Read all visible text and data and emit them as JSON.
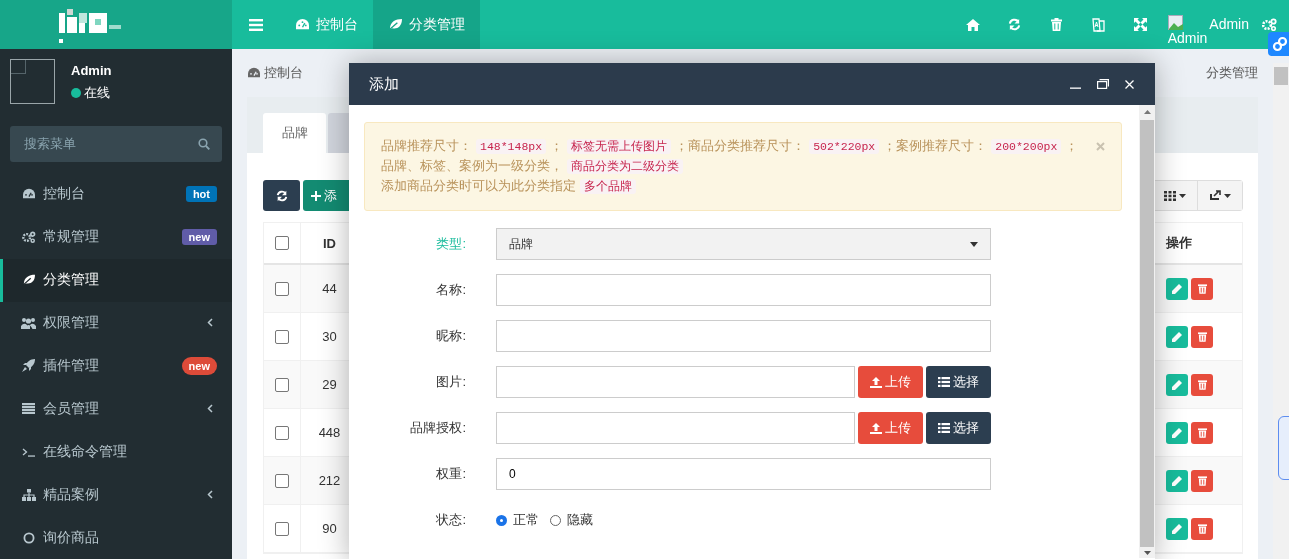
{
  "header": {
    "nav_tabs": [
      {
        "label": "控制台",
        "selected": false
      },
      {
        "label": "分类管理",
        "selected": true
      }
    ],
    "user": {
      "image_alt": "Admin",
      "name": "Admin"
    }
  },
  "sidebar": {
    "user": {
      "name": "Admin",
      "status": "在线"
    },
    "search": {
      "placeholder": "搜索菜单"
    },
    "items": [
      {
        "label": "控制台",
        "badge": {
          "text": "hot",
          "color": "#0073b7",
          "pill": false
        },
        "expandable": false,
        "selected": false
      },
      {
        "label": "常规管理",
        "badge": {
          "text": "new",
          "color": "#605ca8",
          "pill": false
        },
        "expandable": false,
        "selected": false
      },
      {
        "label": "分类管理",
        "expandable": false,
        "selected": true
      },
      {
        "label": "权限管理",
        "expandable": true,
        "selected": false
      },
      {
        "label": "插件管理",
        "badge": {
          "text": "new",
          "color": "#dd4b39",
          "pill": true
        },
        "expandable": false,
        "selected": false
      },
      {
        "label": "会员管理",
        "expandable": true,
        "selected": false
      },
      {
        "label": "在线命令管理",
        "expandable": false,
        "selected": false
      },
      {
        "label": "精品案例",
        "expandable": true,
        "selected": false
      },
      {
        "label": "询价商品",
        "expandable": false,
        "selected": false
      }
    ]
  },
  "breadcrumb": {
    "left": "控制台",
    "right": "分类管理"
  },
  "panel": {
    "tabs": [
      {
        "label": "品牌",
        "selected": true
      },
      {
        "selected": false
      }
    ],
    "add_label": "添",
    "table": {
      "header_checked": false,
      "id_heading": "ID",
      "actions_heading": "操作",
      "rows": [
        {
          "id": "44",
          "checked": false
        },
        {
          "id": "30",
          "checked": false
        },
        {
          "id": "29",
          "checked": false
        },
        {
          "id": "448",
          "checked": false
        },
        {
          "id": "212",
          "checked": false
        },
        {
          "id": "90",
          "checked": false
        }
      ]
    }
  },
  "modal": {
    "title": "添加",
    "alert": {
      "lines": [
        [
          {
            "kind": "text",
            "text": "品牌推荐尺寸："
          },
          {
            "kind": "code",
            "text": "148*148px"
          },
          {
            "kind": "text",
            "text": "；"
          },
          {
            "kind": "code",
            "text": "标签无需上传图片"
          },
          {
            "kind": "text",
            "text": "；商品分类推荐尺寸："
          },
          {
            "kind": "code",
            "text": "502*220px"
          },
          {
            "kind": "text",
            "text": "；案例推荐尺寸："
          },
          {
            "kind": "code",
            "text": "200*200px"
          },
          {
            "kind": "text",
            "text": "；"
          }
        ],
        [
          {
            "kind": "text",
            "text": "品牌、标签、案例为一级分类，"
          },
          {
            "kind": "code",
            "text": "商品分类为二级分类"
          }
        ],
        [
          {
            "kind": "text",
            "text": "添加商品分类时可以为此分类指定"
          },
          {
            "kind": "code",
            "text": "多个品牌"
          }
        ]
      ]
    },
    "fields": [
      {
        "kind": "select",
        "label": "类型:",
        "highlighted": true,
        "value": "品牌"
      },
      {
        "kind": "text",
        "label": "名称:",
        "highlighted": false
      },
      {
        "kind": "text",
        "label": "昵称:",
        "highlighted": false
      },
      {
        "kind": "upload",
        "label": "图片:",
        "highlighted": false,
        "upload_label": "上传",
        "choose_label": "选择"
      },
      {
        "kind": "upload",
        "label": "品牌授权:",
        "highlighted": false,
        "upload_label": "上传",
        "choose_label": "选择"
      },
      {
        "kind": "text",
        "label": "权重:",
        "highlighted": false,
        "value": "0"
      },
      {
        "kind": "radio",
        "label": "状态:",
        "highlighted": false,
        "options": [
          {
            "label": "正常",
            "selected": true
          },
          {
            "label": "隐藏",
            "selected": false
          }
        ]
      }
    ]
  }
}
